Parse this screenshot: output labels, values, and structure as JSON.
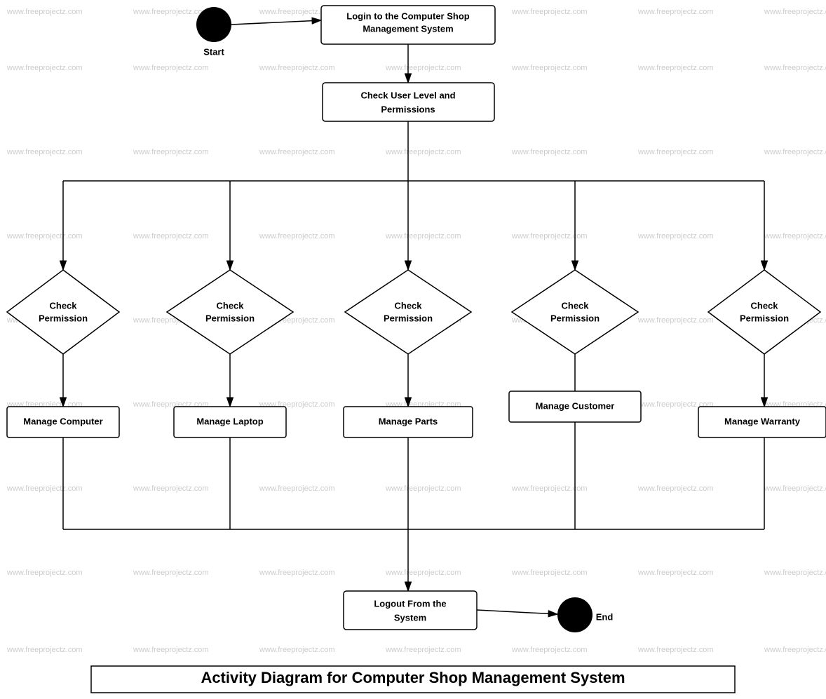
{
  "diagram": {
    "title": "Activity Diagram for Computer Shop Management System",
    "nodes": {
      "start_label": "Start",
      "end_label": "End",
      "login": "Login to the Computer Shop Management System",
      "check_user_level": "Check User Level and\nPermissions",
      "check_perm1": "Check\nPermission",
      "check_perm2": "Check\nPermission",
      "check_perm3": "Check\nPermission",
      "check_perm4": "Check\nPermission",
      "check_perm5": "Check\nPermission",
      "manage_computer": "Manage Computer",
      "manage_laptop": "Manage Laptop",
      "manage_parts": "Manage Parts",
      "manage_customer": "Manage Customer",
      "manage_warranty": "Manage Warranty",
      "logout": "Logout From the\nSystem"
    },
    "watermark": "www.freeprojectz.com"
  }
}
